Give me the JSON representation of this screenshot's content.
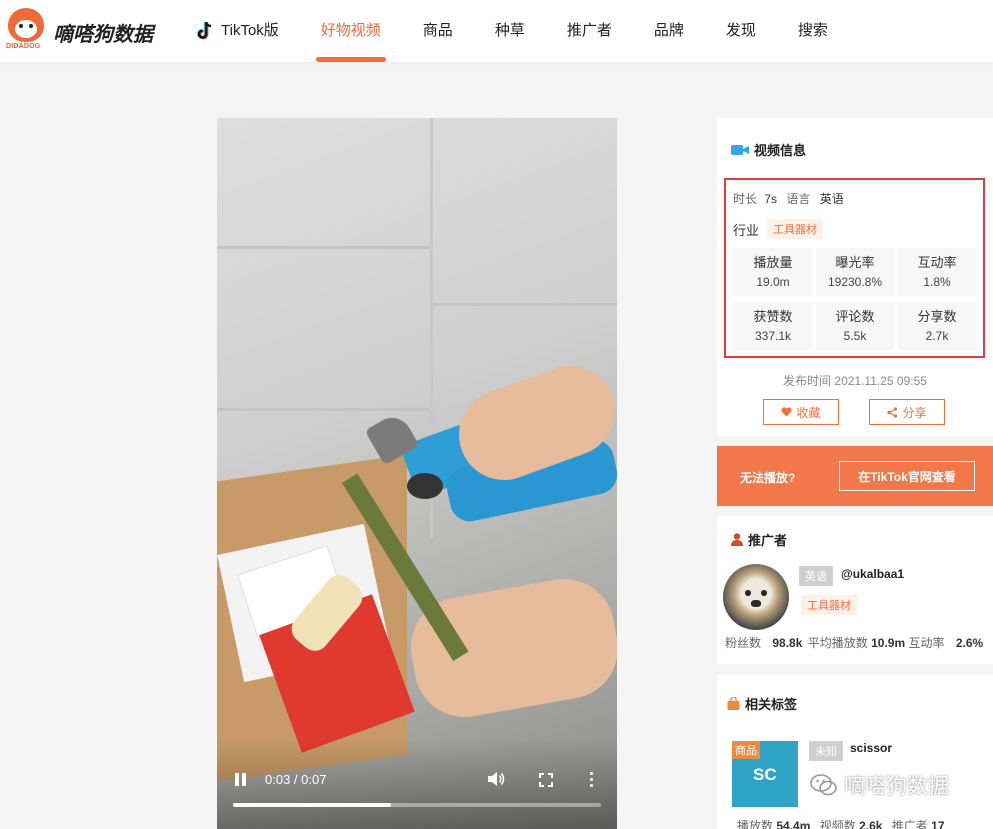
{
  "header": {
    "brand": "嘀嗒狗数据",
    "logo_text": "DIDADOG",
    "nav": [
      {
        "label": "TikTok版",
        "icon": "tiktok-icon"
      },
      {
        "label": "好物视频",
        "active": true
      },
      {
        "label": "商品"
      },
      {
        "label": "种草"
      },
      {
        "label": "推广者"
      },
      {
        "label": "品牌"
      },
      {
        "label": "发现"
      },
      {
        "label": "搜索"
      }
    ]
  },
  "player": {
    "time": "0:03 / 0:07",
    "progress": 0.43
  },
  "video_info": {
    "title": "视频信息",
    "duration_label": "时长",
    "duration": "7s",
    "language_label": "语言",
    "language": "英语",
    "industry_label": "行业",
    "industry_tag": "工具器材",
    "stats": [
      {
        "label": "播放量",
        "value": "19.0m"
      },
      {
        "label": "曝光率",
        "value": "19230.8%"
      },
      {
        "label": "互动率",
        "value": "1.8%"
      },
      {
        "label": "获赞数",
        "value": "337.1k"
      },
      {
        "label": "评论数",
        "value": "5.5k"
      },
      {
        "label": "分享数",
        "value": "2.7k"
      }
    ],
    "publish_label": "发布时间",
    "publish_time": "2021.11.25 09:55",
    "fav_button": "收藏",
    "share_button": "分享"
  },
  "play_bar": {
    "text": "无法播放?",
    "button": "在TikTok官网查看"
  },
  "promoter": {
    "title": "推广者",
    "language_tag": "英语",
    "handle": "@ukalbaa1",
    "category_tag": "工具器材",
    "fans_label": "粉丝数",
    "fans": "98.8k",
    "avg_play_label": "平均播放数",
    "avg_play": "10.9m",
    "engage_label": "互动率",
    "engage": "2.6%"
  },
  "tags": {
    "title": "相关标签",
    "thumb_badge": "商品",
    "thumb_text": "SC",
    "status_tag": "未知",
    "name": "scissor",
    "play_label": "播放数",
    "play": "54.4m",
    "video_label": "视频数",
    "video": "2.6k",
    "promoter_label": "推广者",
    "promoter": "17"
  },
  "watermark": "嘀嗒狗数据",
  "colors": {
    "accent": "#f26b3a",
    "highlight_border": "#e23b3b"
  }
}
